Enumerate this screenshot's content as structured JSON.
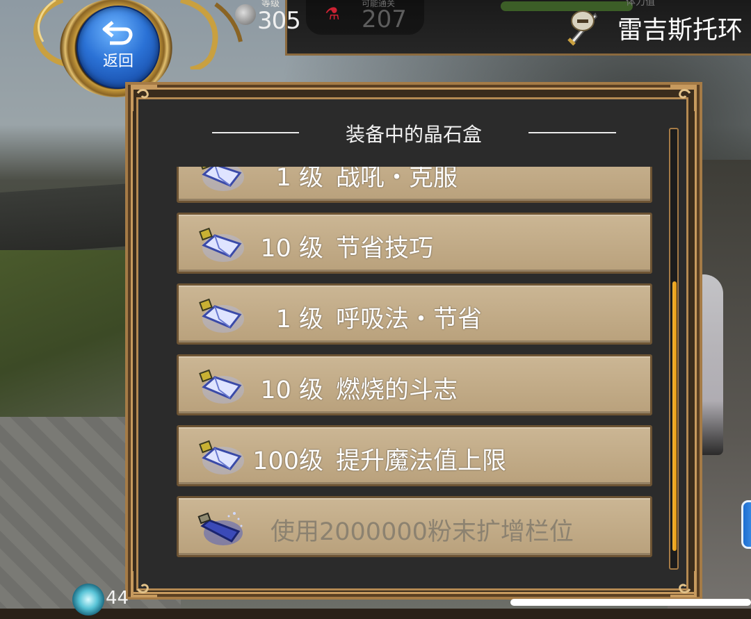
{
  "hud": {
    "level_label": "等级",
    "level_value": "305",
    "stat_label": "可能通关",
    "stat_value": "207",
    "bar_text": "体力值",
    "player_name": "雷吉斯托环"
  },
  "back_button": {
    "label": "返回"
  },
  "panel": {
    "title": "装备中的晶石盒"
  },
  "slots": [
    {
      "level": "1 级",
      "name": "战吼・克服",
      "partial": true
    },
    {
      "level": "10 级",
      "name": "节省技巧"
    },
    {
      "level": "1 级",
      "name": "呼吸法・节省"
    },
    {
      "level": "10 级",
      "name": "燃烧的斗志"
    },
    {
      "level": "100级",
      "name": "提升魔法值上限"
    }
  ],
  "expand_slot": {
    "label": "使用2000000粉末扩增栏位"
  },
  "bottom": {
    "value": "44"
  },
  "colors": {
    "slot_bg": "#c2ab86",
    "panel_border": "#a57b46",
    "scroll_thumb": "#f2b233",
    "back_button_blue": "#2b72d6"
  },
  "icons": [
    "back-arrow-icon",
    "sword-helmet-icon",
    "crystal-box-icon",
    "level-icon",
    "potion-icon"
  ]
}
